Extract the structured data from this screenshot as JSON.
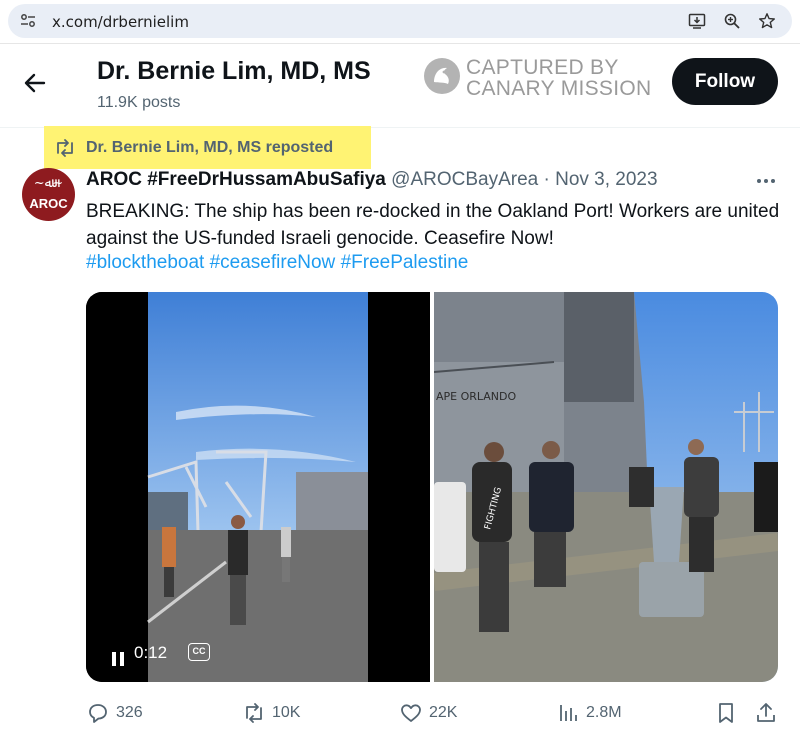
{
  "browser": {
    "url": "x.com/drbernielim",
    "icons": [
      "site-info-icon",
      "install-app-icon",
      "zoom-icon",
      "bookmark-star-icon"
    ]
  },
  "header": {
    "name": "Dr. Bernie Lim, MD, MS",
    "posts": "11.9K posts",
    "follow_label": "Follow"
  },
  "watermark": {
    "line1": "CAPTURED BY",
    "line2": "CANARY MISSION"
  },
  "repost": {
    "text": "Dr. Bernie Lim, MD, MS reposted",
    "highlight_color": "#fff373"
  },
  "tweet": {
    "avatar_text": "AROC",
    "author_name": "AROC #FreeDrHussamAbuSafiya",
    "handle": "@AROCBayArea",
    "separator": "·",
    "date": "Nov 3, 2023",
    "body": "BREAKING: The ship has been re-docked in the Oakland Port! Workers are united against the US-funded Israeli genocide. Ceasefire Now!",
    "hashtags": [
      "#blocktheboat",
      "#ceasefireNow",
      "#FreePalestine"
    ],
    "video_time": "0:12",
    "cc_label": "CC",
    "ship_text": "APE ORLANDO",
    "hoodie_text": "FIGHTING"
  },
  "actions": {
    "replies": "326",
    "reposts": "10K",
    "likes": "22K",
    "views": "2.8M"
  },
  "colors": {
    "accent": "#1d9bf0",
    "text": "#0f1419",
    "secondary": "#536471",
    "brand_avatar": "#8e1b1f"
  }
}
